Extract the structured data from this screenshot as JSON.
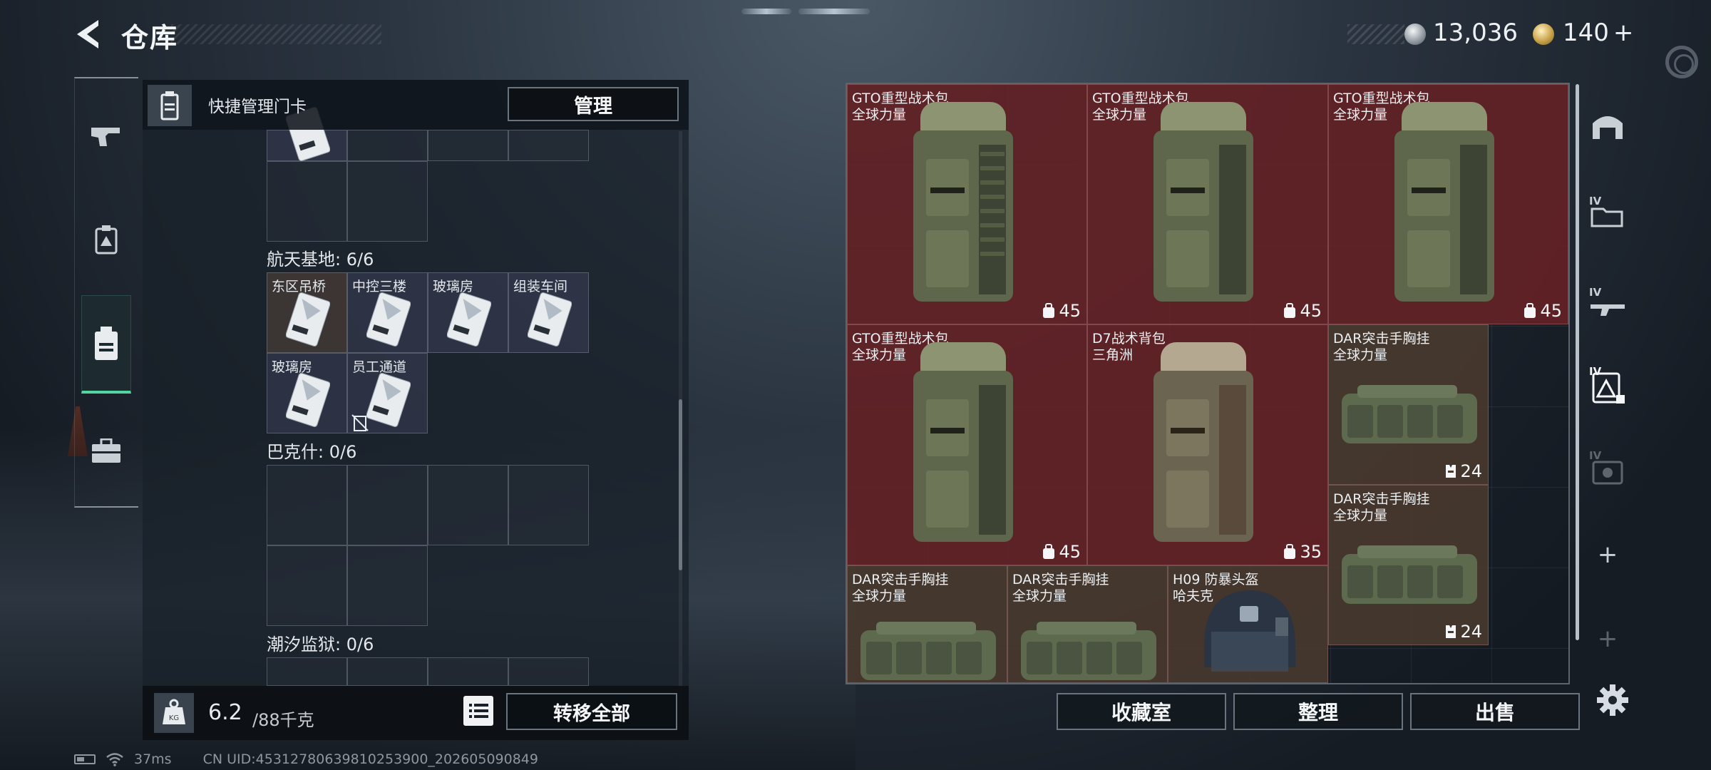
{
  "header": {
    "title": "仓库"
  },
  "currency": {
    "coin_value": "13,036",
    "gem_value": "140",
    "gem_plus": "+"
  },
  "left_header": {
    "label": "快捷管理门卡",
    "manage_label": "管理"
  },
  "sections": [
    {
      "title": "航天基地: 6/6",
      "cards": [
        "东区吊桥",
        "中控三楼",
        "玻璃房",
        "组装车间",
        "玻璃房",
        "员工通道"
      ]
    },
    {
      "title": "巴克什: 0/6"
    },
    {
      "title": "潮汐监狱: 0/6"
    }
  ],
  "weight": {
    "current": "6.2",
    "max": "/88千克"
  },
  "transfer_label": "转移全部",
  "status": {
    "ping": "37ms",
    "uid": "CN UID:4531278063981025390​0_202605090849"
  },
  "stash_items": [
    {
      "name": "GTO重型战术包",
      "origin": "全球力量",
      "count": "45"
    },
    {
      "name": "GTO重型战术包",
      "origin": "全球力量",
      "count": "45"
    },
    {
      "name": "GTO重型战术包",
      "origin": "全球力量",
      "count": "45"
    },
    {
      "name": "GTO重型战术包",
      "origin": "全球力量",
      "count": "45"
    },
    {
      "name": "D7战术背包",
      "origin": "三角洲",
      "count": "35"
    },
    {
      "name": "DAR突击手胸挂",
      "origin": "全球力量",
      "count": "24"
    },
    {
      "name": "DAR突击手胸挂",
      "origin": "全球力量",
      "count": "24"
    },
    {
      "name": "DAR突击手胸挂",
      "origin": "全球力量"
    },
    {
      "name": "DAR突击手胸挂",
      "origin": "全球力量"
    },
    {
      "name": "H09 防暴头盔",
      "origin": "哈夫克"
    }
  ],
  "buttons": {
    "collection": "收藏室",
    "sort": "整理",
    "sell": "出售"
  },
  "tabs": [
    {
      "icon": "stash-room-icon"
    },
    {
      "icon": "tier4-folder-icon",
      "label": "IV"
    },
    {
      "icon": "tier4-rifle-icon",
      "label": "IV"
    },
    {
      "icon": "tier4-armor-icon",
      "label": "IV"
    },
    {
      "icon": "tier4-medkit-icon",
      "label": "IV"
    },
    {
      "icon": "add-tab-icon",
      "label": "+"
    },
    {
      "icon": "add-tab-icon-disabled",
      "label": "+"
    }
  ],
  "colors": {
    "accent": "#52d6a0",
    "item_red": "#66222a",
    "item_brown": "#4a3a2e"
  }
}
